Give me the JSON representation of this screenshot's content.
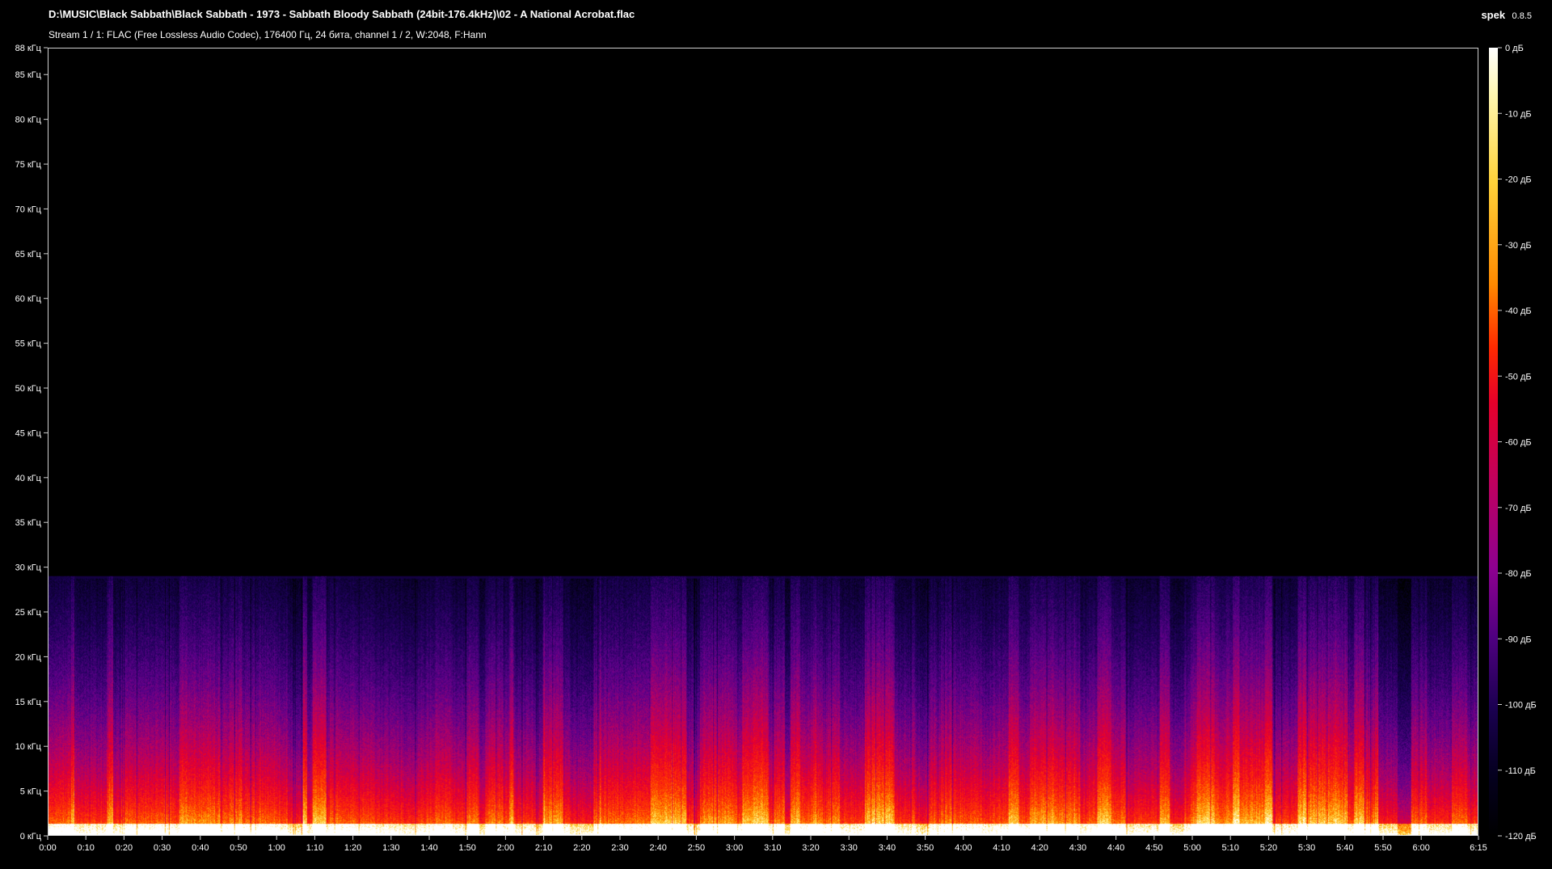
{
  "header": {
    "file_path": "D:\\MUSIC\\Black Sabbath\\Black Sabbath - 1973 - Sabbath Bloody Sabbath (24bit-176.4kHz)\\02 - A National Acrobat.flac",
    "stream_info": "Stream 1 / 1: FLAC (Free Lossless Audio Codec), 176400 Гц, 24 бита, channel 1 / 2, W:2048, F:Hann",
    "app_name": "spek",
    "app_version": "0.8.5"
  },
  "chart_data": {
    "type": "heatmap",
    "x_range": [
      0,
      375
    ],
    "y_range": [
      0,
      88
    ],
    "x_ticks": [
      {
        "value": 0,
        "label": "0:00"
      },
      {
        "value": 10,
        "label": "0:10"
      },
      {
        "value": 20,
        "label": "0:20"
      },
      {
        "value": 30,
        "label": "0:30"
      },
      {
        "value": 40,
        "label": "0:40"
      },
      {
        "value": 50,
        "label": "0:50"
      },
      {
        "value": 60,
        "label": "1:00"
      },
      {
        "value": 70,
        "label": "1:10"
      },
      {
        "value": 80,
        "label": "1:20"
      },
      {
        "value": 90,
        "label": "1:30"
      },
      {
        "value": 100,
        "label": "1:40"
      },
      {
        "value": 110,
        "label": "1:50"
      },
      {
        "value": 120,
        "label": "2:00"
      },
      {
        "value": 130,
        "label": "2:10"
      },
      {
        "value": 140,
        "label": "2:20"
      },
      {
        "value": 150,
        "label": "2:30"
      },
      {
        "value": 160,
        "label": "2:40"
      },
      {
        "value": 170,
        "label": "2:50"
      },
      {
        "value": 180,
        "label": "3:00"
      },
      {
        "value": 190,
        "label": "3:10"
      },
      {
        "value": 200,
        "label": "3:20"
      },
      {
        "value": 210,
        "label": "3:30"
      },
      {
        "value": 220,
        "label": "3:40"
      },
      {
        "value": 230,
        "label": "3:50"
      },
      {
        "value": 240,
        "label": "4:00"
      },
      {
        "value": 250,
        "label": "4:10"
      },
      {
        "value": 260,
        "label": "4:20"
      },
      {
        "value": 270,
        "label": "4:30"
      },
      {
        "value": 280,
        "label": "4:40"
      },
      {
        "value": 290,
        "label": "4:50"
      },
      {
        "value": 300,
        "label": "5:00"
      },
      {
        "value": 310,
        "label": "5:10"
      },
      {
        "value": 320,
        "label": "5:20"
      },
      {
        "value": 330,
        "label": "5:30"
      },
      {
        "value": 340,
        "label": "5:40"
      },
      {
        "value": 350,
        "label": "5:50"
      },
      {
        "value": 360,
        "label": "6:00"
      },
      {
        "value": 375,
        "label": "6:15"
      }
    ],
    "y_ticks": [
      {
        "value": 0,
        "label": "0 кГц"
      },
      {
        "value": 5,
        "label": "5 кГц"
      },
      {
        "value": 10,
        "label": "10 кГц"
      },
      {
        "value": 15,
        "label": "15 кГц"
      },
      {
        "value": 20,
        "label": "20 кГц"
      },
      {
        "value": 25,
        "label": "25 кГц"
      },
      {
        "value": 30,
        "label": "30 кГц"
      },
      {
        "value": 35,
        "label": "35 кГц"
      },
      {
        "value": 40,
        "label": "40 кГц"
      },
      {
        "value": 45,
        "label": "45 кГц"
      },
      {
        "value": 50,
        "label": "50 кГц"
      },
      {
        "value": 55,
        "label": "55 кГц"
      },
      {
        "value": 60,
        "label": "60 кГц"
      },
      {
        "value": 65,
        "label": "65 кГц"
      },
      {
        "value": 70,
        "label": "70 кГц"
      },
      {
        "value": 75,
        "label": "75 кГц"
      },
      {
        "value": 80,
        "label": "80 кГц"
      },
      {
        "value": 85,
        "label": "85 кГц"
      },
      {
        "value": 88,
        "label": "88 кГц"
      }
    ],
    "db_range": [
      -120,
      0
    ],
    "db_ticks": [
      {
        "value": 0,
        "label": "0 дБ"
      },
      {
        "value": -10,
        "label": "-10 дБ"
      },
      {
        "value": -20,
        "label": "-20 дБ"
      },
      {
        "value": -30,
        "label": "-30 дБ"
      },
      {
        "value": -40,
        "label": "-40 дБ"
      },
      {
        "value": -50,
        "label": "-50 дБ"
      },
      {
        "value": -60,
        "label": "-60 дБ"
      },
      {
        "value": -70,
        "label": "-70 дБ"
      },
      {
        "value": -80,
        "label": "-80 дБ"
      },
      {
        "value": -90,
        "label": "-90 дБ"
      },
      {
        "value": -100,
        "label": "-100 дБ"
      },
      {
        "value": -110,
        "label": "-110 дБ"
      },
      {
        "value": -120,
        "label": "-120 дБ"
      }
    ],
    "frequency_cutoff_khz": 29,
    "colormap": [
      "#000000",
      "#1a0050",
      "#8e0090",
      "#e5002a",
      "#ff8a00",
      "#fff7b0",
      "#ffffff"
    ]
  }
}
